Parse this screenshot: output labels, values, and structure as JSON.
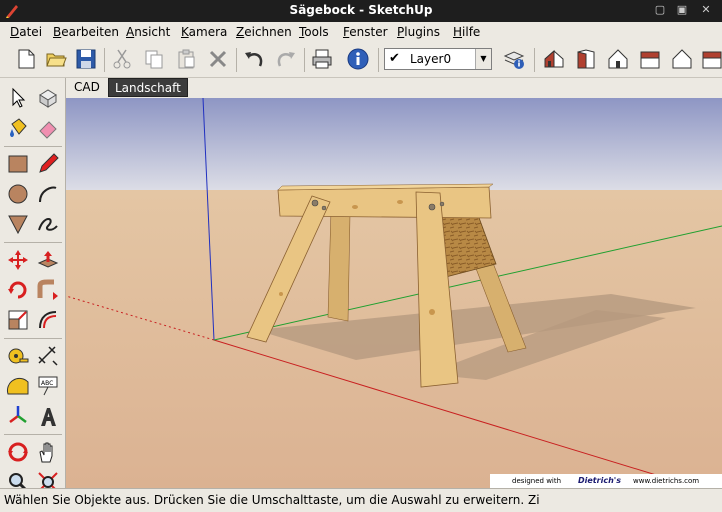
{
  "window": {
    "title": "Sägebock - SketchUp"
  },
  "menubar": {
    "items": [
      {
        "label": "Datei",
        "accel": "D"
      },
      {
        "label": "Bearbeiten",
        "accel": "B"
      },
      {
        "label": "Ansicht",
        "accel": "A"
      },
      {
        "label": "Kamera",
        "accel": "K"
      },
      {
        "label": "Zeichnen",
        "accel": "Z"
      },
      {
        "label": "Tools",
        "accel": "T"
      },
      {
        "label": "Fenster",
        "accel": "F"
      },
      {
        "label": "Plugins",
        "accel": "P"
      },
      {
        "label": "Hilfe",
        "accel": "H"
      }
    ]
  },
  "toolbar": {
    "icons": [
      "new-file-icon",
      "open-folder-icon",
      "save-icon",
      "cut-icon",
      "copy-icon",
      "paste-icon",
      "delete-icon",
      "undo-icon",
      "redo-icon",
      "print-icon",
      "model-info-icon",
      "layer-manager-icon",
      "iso-view-icon",
      "front-view-icon",
      "top-view-icon",
      "right-view-icon",
      "back-view-icon"
    ],
    "layer": {
      "selected": "Layer0"
    }
  },
  "scenes": {
    "tabs": [
      {
        "label": "CAD"
      },
      {
        "label": "Landschaft"
      }
    ]
  },
  "palette": {
    "tools": [
      "select-arrow-icon",
      "make-component-icon",
      "paint-bucket-icon",
      "eraser-icon",
      "rectangle-icon",
      "pencil-icon",
      "circle-icon",
      "arc-icon",
      "polygon-icon",
      "freehand-icon",
      "move-icon",
      "push-pull-icon",
      "rotate-icon",
      "follow-me-icon",
      "scale-icon",
      "offset-icon",
      "tape-measure-icon",
      "dimension-icon",
      "protractor-icon",
      "text-icon",
      "axes-icon",
      "3d-text-icon",
      "orbit-icon",
      "pan-icon",
      "zoom-icon",
      "zoom-extents-icon"
    ]
  },
  "viewport": {
    "colors": {
      "sky_top": "#8e96c4",
      "sky_bottom": "#dcdde6",
      "ground_far": "#e4c6a4",
      "ground_near": "#dbb292",
      "wood": "#e9c583",
      "wood_dark": "#c8964e",
      "osb": "#b88945",
      "shadow": "#b59a7f"
    },
    "brand": {
      "designed_with": "designed with",
      "company": "Dietrich's",
      "url": "www.dietrichs.com"
    }
  },
  "statusbar": {
    "text": "Wählen Sie Objekte aus. Drücken Sie die Umschalttaste, um die Auswahl zu erweitern. Zi"
  }
}
